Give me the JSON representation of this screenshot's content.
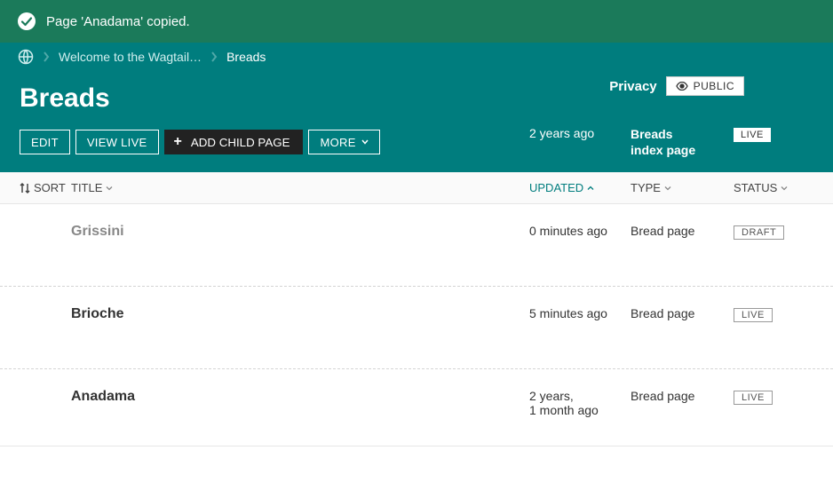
{
  "notification": {
    "text": "Page 'Anadama' copied."
  },
  "breadcrumb": {
    "root_label": "Welcome to the Wagtail…",
    "current": "Breads"
  },
  "header": {
    "title": "Breads",
    "privacy_label": "Privacy",
    "privacy_value": "PUBLIC",
    "updated": "2 years ago",
    "type_line1": "Breads",
    "type_line2": "index page",
    "status": "LIVE",
    "buttons": {
      "edit": "EDIT",
      "view_live": "VIEW LIVE",
      "add_child": "ADD CHILD PAGE",
      "more": "MORE"
    }
  },
  "columns": {
    "sort": "SORT",
    "title": "TITLE",
    "updated": "UPDATED",
    "type": "TYPE",
    "status": "STATUS"
  },
  "rows": [
    {
      "title": "Grissini",
      "updated": "0 minutes ago",
      "type": "Bread page",
      "status": "DRAFT",
      "is_draft": true
    },
    {
      "title": "Brioche",
      "updated": "5 minutes ago",
      "type": "Bread page",
      "status": "LIVE",
      "is_draft": false
    },
    {
      "title": "Anadama",
      "updated": "2 years,\n1 month ago",
      "type": "Bread page",
      "status": "LIVE",
      "is_draft": false
    }
  ]
}
